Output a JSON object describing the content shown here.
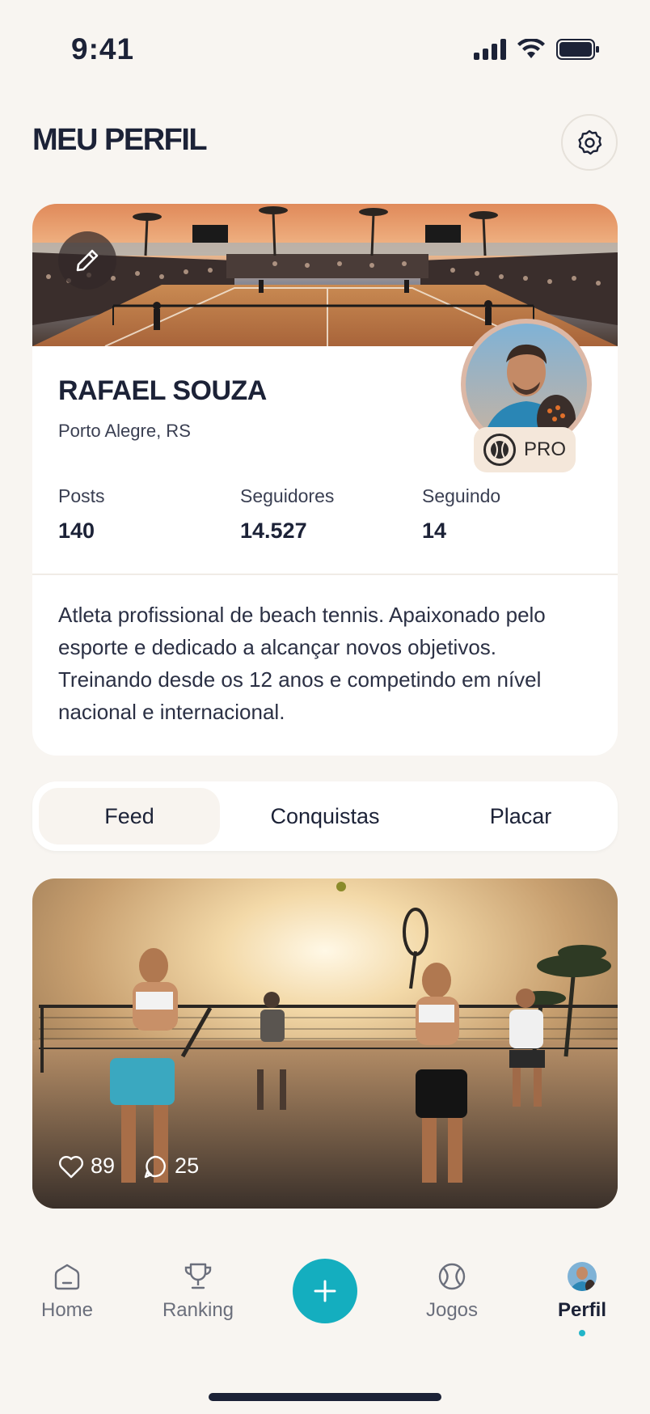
{
  "status_bar": {
    "time": "9:41"
  },
  "header": {
    "title": "MEU PERFIL"
  },
  "profile": {
    "name": "RAFAEL SOUZA",
    "location": "Porto Alegre, RS",
    "badge": "PRO",
    "stats": [
      {
        "label": "Posts",
        "value": "140"
      },
      {
        "label": "Seguidores",
        "value": "14.527"
      },
      {
        "label": "Seguindo",
        "value": "14"
      }
    ],
    "bio": "Atleta profissional de beach tennis. Apaixonado pelo esporte e dedicado a alcançar novos objetivos. Treinando desde os 12 anos e competindo em nível nacional e internacional."
  },
  "tabs": [
    {
      "label": "Feed",
      "active": true
    },
    {
      "label": "Conquistas",
      "active": false
    },
    {
      "label": "Placar",
      "active": false
    }
  ],
  "post": {
    "likes": "89",
    "comments": "25"
  },
  "nav": [
    {
      "label": "Home",
      "icon": "home-icon"
    },
    {
      "label": "Ranking",
      "icon": "trophy-icon"
    },
    {
      "label": "Jogos",
      "icon": "ball-icon"
    },
    {
      "label": "Perfil",
      "icon": "avatar"
    }
  ],
  "colors": {
    "accent": "#14aebf",
    "background": "#f8f5f1",
    "text": "#1c2237"
  }
}
